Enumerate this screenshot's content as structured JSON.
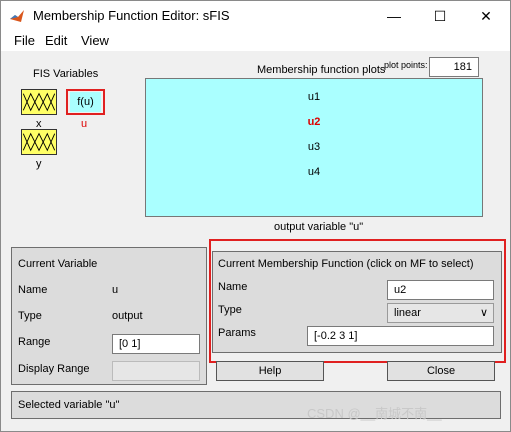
{
  "window": {
    "title": "Membership Function Editor: sFIS",
    "minimize_icon": "minimize-icon",
    "maximize_icon": "maximize-icon",
    "close_icon": "close-icon"
  },
  "menu": {
    "file": "File",
    "edit": "Edit",
    "view": "View"
  },
  "fis": {
    "header": "FIS Variables",
    "x_label": "x",
    "u_box": "f(u)",
    "u_label": "u",
    "y_label": "y"
  },
  "plot": {
    "title": "Membership function plots",
    "points_label": "plot points:",
    "points_value": "181",
    "mfs": [
      "u1",
      "u2",
      "u3",
      "u4"
    ],
    "selected_color": "#dd0000",
    "caption": "output variable \"u\""
  },
  "current_variable": {
    "header": "Current Variable",
    "name_label": "Name",
    "name_value": "u",
    "type_label": "Type",
    "type_value": "output",
    "range_label": "Range",
    "range_value": "[0 1]",
    "display_range_label": "Display Range",
    "display_range_value": ""
  },
  "current_mf": {
    "header": "Current Membership Function (click on MF to select)",
    "name_label": "Name",
    "name_value": "u2",
    "type_label": "Type",
    "type_value": "linear",
    "params_label": "Params",
    "params_value": "[-0.2 3 1]"
  },
  "buttons": {
    "help": "Help",
    "close": "Close"
  },
  "status": "Selected variable \"u\"",
  "watermark": "CSDN @__南城不南__",
  "colors": {
    "plot_bg": "#aaffff",
    "mf_box": "#ffff66",
    "highlight": "#e02020"
  }
}
